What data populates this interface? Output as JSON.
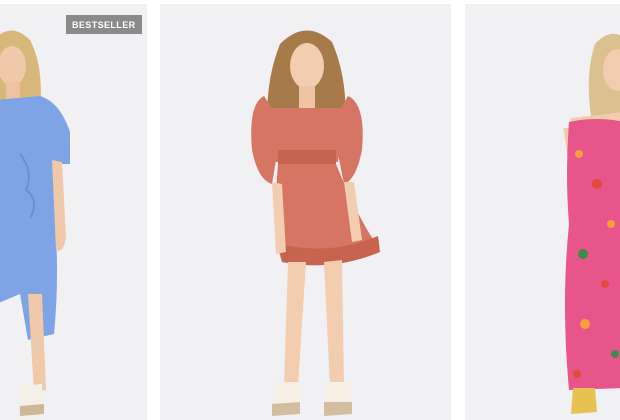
{
  "products": [
    {
      "badge": "BESTSELLER",
      "image": "model-blue-dress-image",
      "dress_color": "#7fa4e6"
    },
    {
      "image": "model-coral-dress-image",
      "dress_color": "#d77564"
    },
    {
      "image": "model-floral-maxi-dress-image",
      "dress_color": "#e8558a"
    }
  ]
}
